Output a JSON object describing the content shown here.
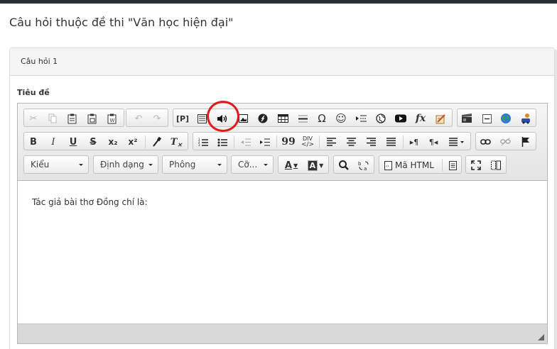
{
  "page": {
    "title": "Câu hỏi thuộc đề thi \"Văn học hiện đại\""
  },
  "panel": {
    "heading": "Câu hỏi 1"
  },
  "field": {
    "label": "Tiêu đề"
  },
  "toolbar": {
    "row1": {
      "clipboard": [
        "Cut",
        "Copy",
        "Paste",
        "Paste as plain text",
        "Paste from Word"
      ],
      "undo_redo": [
        "Undo",
        "Redo"
      ],
      "insert_p_label": "[P]",
      "insert_group": [
        "Insert P",
        "Template",
        "Audio",
        "Image",
        "Flash",
        "Table",
        "Horizontal Line",
        "Special Character",
        "Smiley",
        "Page Break",
        "IFrame",
        "YouTube",
        "Math formula",
        "Template edit"
      ],
      "symbols": {
        "omega": "Ω",
        "fx": "fx"
      },
      "media_group": [
        "Video",
        "Collapse",
        "Globe",
        "Teaching tool"
      ]
    },
    "row2": {
      "basic": [
        "B",
        "I",
        "U",
        "S",
        "x₂",
        "x²"
      ],
      "tx_label": "T",
      "blocks_label": "DIV",
      "quote_label": "99"
    },
    "row3": {
      "style_combo": "Kiểu",
      "format_combo": "Định dạng",
      "font_combo": "Phông",
      "size_combo": "Cỡ...",
      "text_color_label": "A",
      "bg_color_label": "A",
      "source_label": "Mã HTML"
    }
  },
  "editor": {
    "content": "Tác giả bài thơ Đồng chí là:"
  },
  "annotation": {
    "circle_color": "#e01b1b"
  }
}
